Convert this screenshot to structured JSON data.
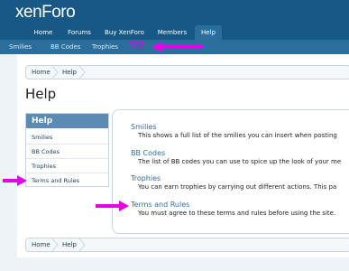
{
  "header": {
    "logo": "xenForo",
    "tabs": [
      {
        "label": "Home"
      },
      {
        "label": "Forums"
      },
      {
        "label": "Buy XenForo"
      },
      {
        "label": "Members"
      },
      {
        "label": "Help"
      }
    ],
    "sub_links": [
      {
        "label": "Smilies"
      },
      {
        "label": "BB Codes"
      },
      {
        "label": "Trophies"
      }
    ]
  },
  "annotations": {
    "question_marks": "???",
    "color": "#e600e6"
  },
  "breadcrumb": [
    {
      "label": "Home"
    },
    {
      "label": "Help"
    }
  ],
  "page_title": "Help",
  "sidebar": {
    "title": "Help",
    "items": [
      {
        "label": "Smilies"
      },
      {
        "label": "BB Codes"
      },
      {
        "label": "Trophies"
      },
      {
        "label": "Terms and Rules"
      }
    ]
  },
  "sections": [
    {
      "title": "Smilies",
      "desc": "This shows a full list of the smilies you can insert when posting"
    },
    {
      "title": "BB Codes",
      "desc": "The list of BB codes you can use to spice up the look of your me"
    },
    {
      "title": "Trophies",
      "desc": "You can earn trophies by carrying out different actions.  This pa"
    },
    {
      "title": "Terms and Rules",
      "desc": "You must agree to these terms and rules before using the site."
    }
  ],
  "colors": {
    "header": "#185886",
    "subnav": "#2b6d9c",
    "link": "#2b6d9c",
    "arrow": "#e600e6"
  }
}
